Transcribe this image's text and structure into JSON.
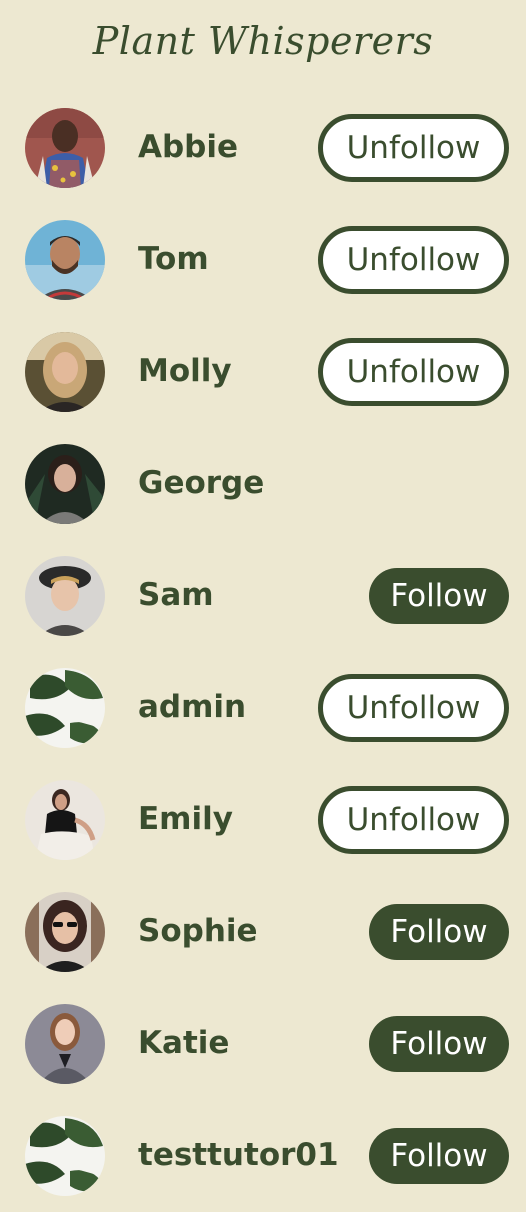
{
  "header": {
    "title": "Plant Whisperers"
  },
  "colors": {
    "background": "#ede8d1",
    "accent": "#3a4d2e",
    "button_light": "#ffffff"
  },
  "users": [
    {
      "name": "Abbie",
      "action": "Unfollow",
      "avatar": "woman-smiling-photo"
    },
    {
      "name": "Tom",
      "action": "Unfollow",
      "avatar": "bearded-man-photo"
    },
    {
      "name": "Molly",
      "action": "Unfollow",
      "avatar": "blonde-woman-photo"
    },
    {
      "name": "George",
      "action": "",
      "avatar": "dark-haired-woman-photo"
    },
    {
      "name": "Sam",
      "action": "Follow",
      "avatar": "man-with-hat-photo"
    },
    {
      "name": "admin",
      "action": "Unfollow",
      "avatar": "monstera-leaf-photo"
    },
    {
      "name": "Emily",
      "action": "Unfollow",
      "avatar": "seated-woman-photo"
    },
    {
      "name": "Sophie",
      "action": "Follow",
      "avatar": "woman-sunglasses-photo"
    },
    {
      "name": "Katie",
      "action": "Follow",
      "avatar": "woman-blazer-photo"
    },
    {
      "name": "testtutor01",
      "action": "Follow",
      "avatar": "monstera-leaf-photo"
    }
  ]
}
